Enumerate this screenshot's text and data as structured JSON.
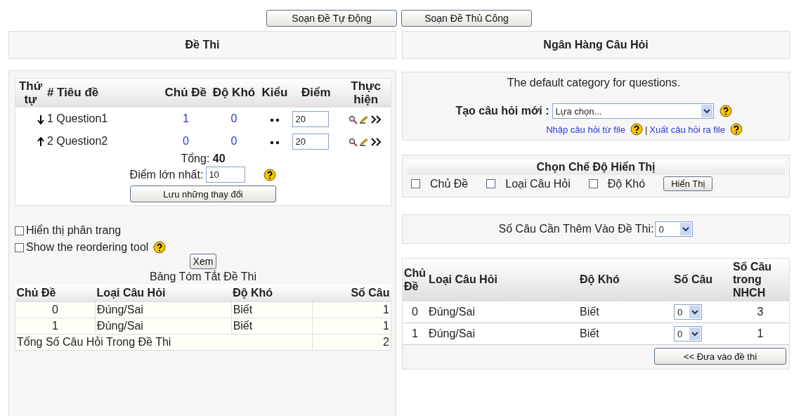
{
  "top_buttons": [
    "Soạn Đề Tự Động",
    "Soạn Đề Thủ Công"
  ],
  "exam": {
    "title": "Đề Thi",
    "columns": [
      "Thứ tự",
      "# Tiêu đề",
      "Chủ Đề",
      "Độ Khó",
      "Kiểu",
      "Điểm",
      "Thực hiện"
    ],
    "questions": [
      {
        "kind": "down",
        "number": "1",
        "name": "Question1",
        "topic": "1",
        "difficulty": "0",
        "points": "20"
      },
      {
        "kind": "up",
        "number": "2",
        "name": "Question2",
        "topic": "0",
        "difficulty": "0",
        "points": "20"
      }
    ],
    "total_label": "Tổng:",
    "total": "40",
    "max_label": "Điểm lớn nhất:",
    "max_value": "10",
    "save_button": "Lưu những thay đổi",
    "options": [
      {
        "label": "Hiển thị phân trang",
        "checked": false,
        "help": false
      },
      {
        "label": "Show the reordering tool",
        "checked": false,
        "help": true
      }
    ],
    "view_button": "Xem",
    "summary": {
      "title": "Bảng Tóm Tắt Đề Thi",
      "columns": [
        "Chủ Đề",
        "Loại Câu Hỏi",
        "Độ Khó",
        "Số Câu"
      ],
      "rows": [
        [
          "0",
          "Đúng/Sai",
          "Biết",
          "1"
        ],
        [
          "1",
          "Đúng/Sai",
          "Biết",
          "1"
        ]
      ],
      "total_label": "Tổng Số Câu Hỏi Trong Đề Thi",
      "total": "2"
    }
  },
  "bank": {
    "title": "Ngân Hàng Câu Hỏi",
    "category": "The default category for questions.",
    "create_label": "Tạo câu hỏi mới :",
    "create_select": "Lựa chọn...",
    "import_link": "Nhập câu hỏi từ file",
    "separator": "|",
    "export_link": "Xuất câu hỏi ra file",
    "display": {
      "title": "Chọn Chế Độ Hiển Thị",
      "options": [
        {
          "label": "Chủ Đề",
          "checked": false
        },
        {
          "label": "Loại Câu Hỏi",
          "checked": false
        },
        {
          "label": "Độ Khó",
          "checked": false
        }
      ],
      "button": "Hiển Thị"
    },
    "add_count": {
      "label": "Số Câu Cần Thêm Vào Đề Thi:",
      "value": "0"
    },
    "table": {
      "columns": [
        "Chủ Đề",
        "Loại Câu Hỏi",
        "Độ Khó",
        "Số Câu",
        "Số Câu trong NHCH"
      ],
      "rows": [
        {
          "topic": "0",
          "type": "Đúng/Sai",
          "difficulty": "Biết",
          "count": "0",
          "available": "3"
        },
        {
          "topic": "1",
          "type": "Đúng/Sai",
          "difficulty": "Biết",
          "count": "0",
          "available": "1"
        }
      ]
    },
    "add_button": "<< Đưa vào đề thi"
  }
}
